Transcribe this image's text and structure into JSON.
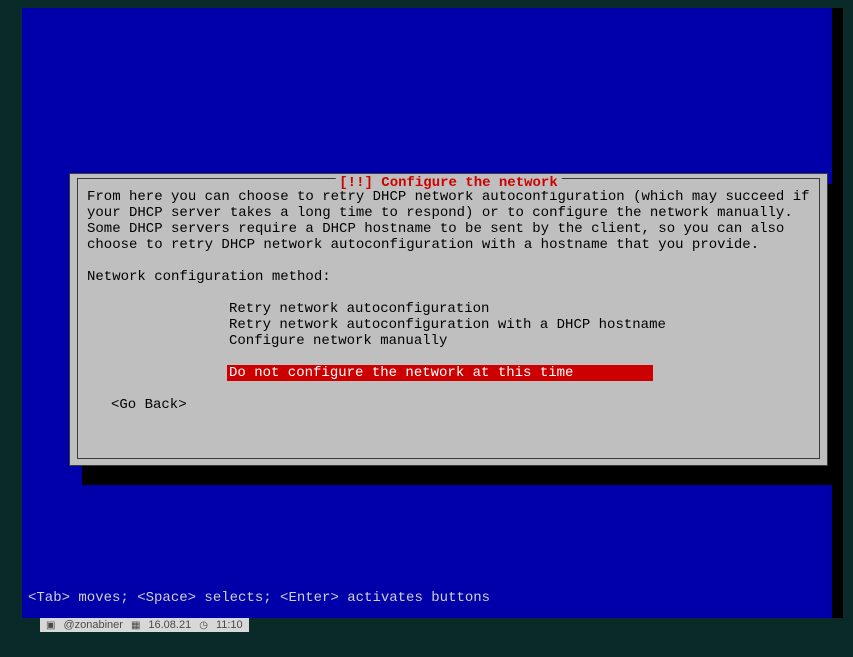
{
  "dialog": {
    "title": "[!!] Configure the network",
    "description": "From here you can choose to retry DHCP network autoconfiguration (which may succeed if your DHCP server takes a long time to respond) or to configure the network manually. Some DHCP servers require a DHCP hostname to be sent by the client, so you can also choose to retry DHCP network autoconfiguration with a hostname that you provide.",
    "prompt": "Network configuration method:",
    "options": [
      "Retry network autoconfiguration",
      "Retry network autoconfiguration with a DHCP hostname",
      "Configure network manually",
      "Do not configure the network at this time"
    ],
    "go_back": "<Go Back>"
  },
  "footer": {
    "hint": "<Tab> moves; <Space> selects; <Enter> activates buttons"
  },
  "statusbar": {
    "user": "@zonabiner",
    "date": "16.08.21",
    "time": "11:10"
  }
}
